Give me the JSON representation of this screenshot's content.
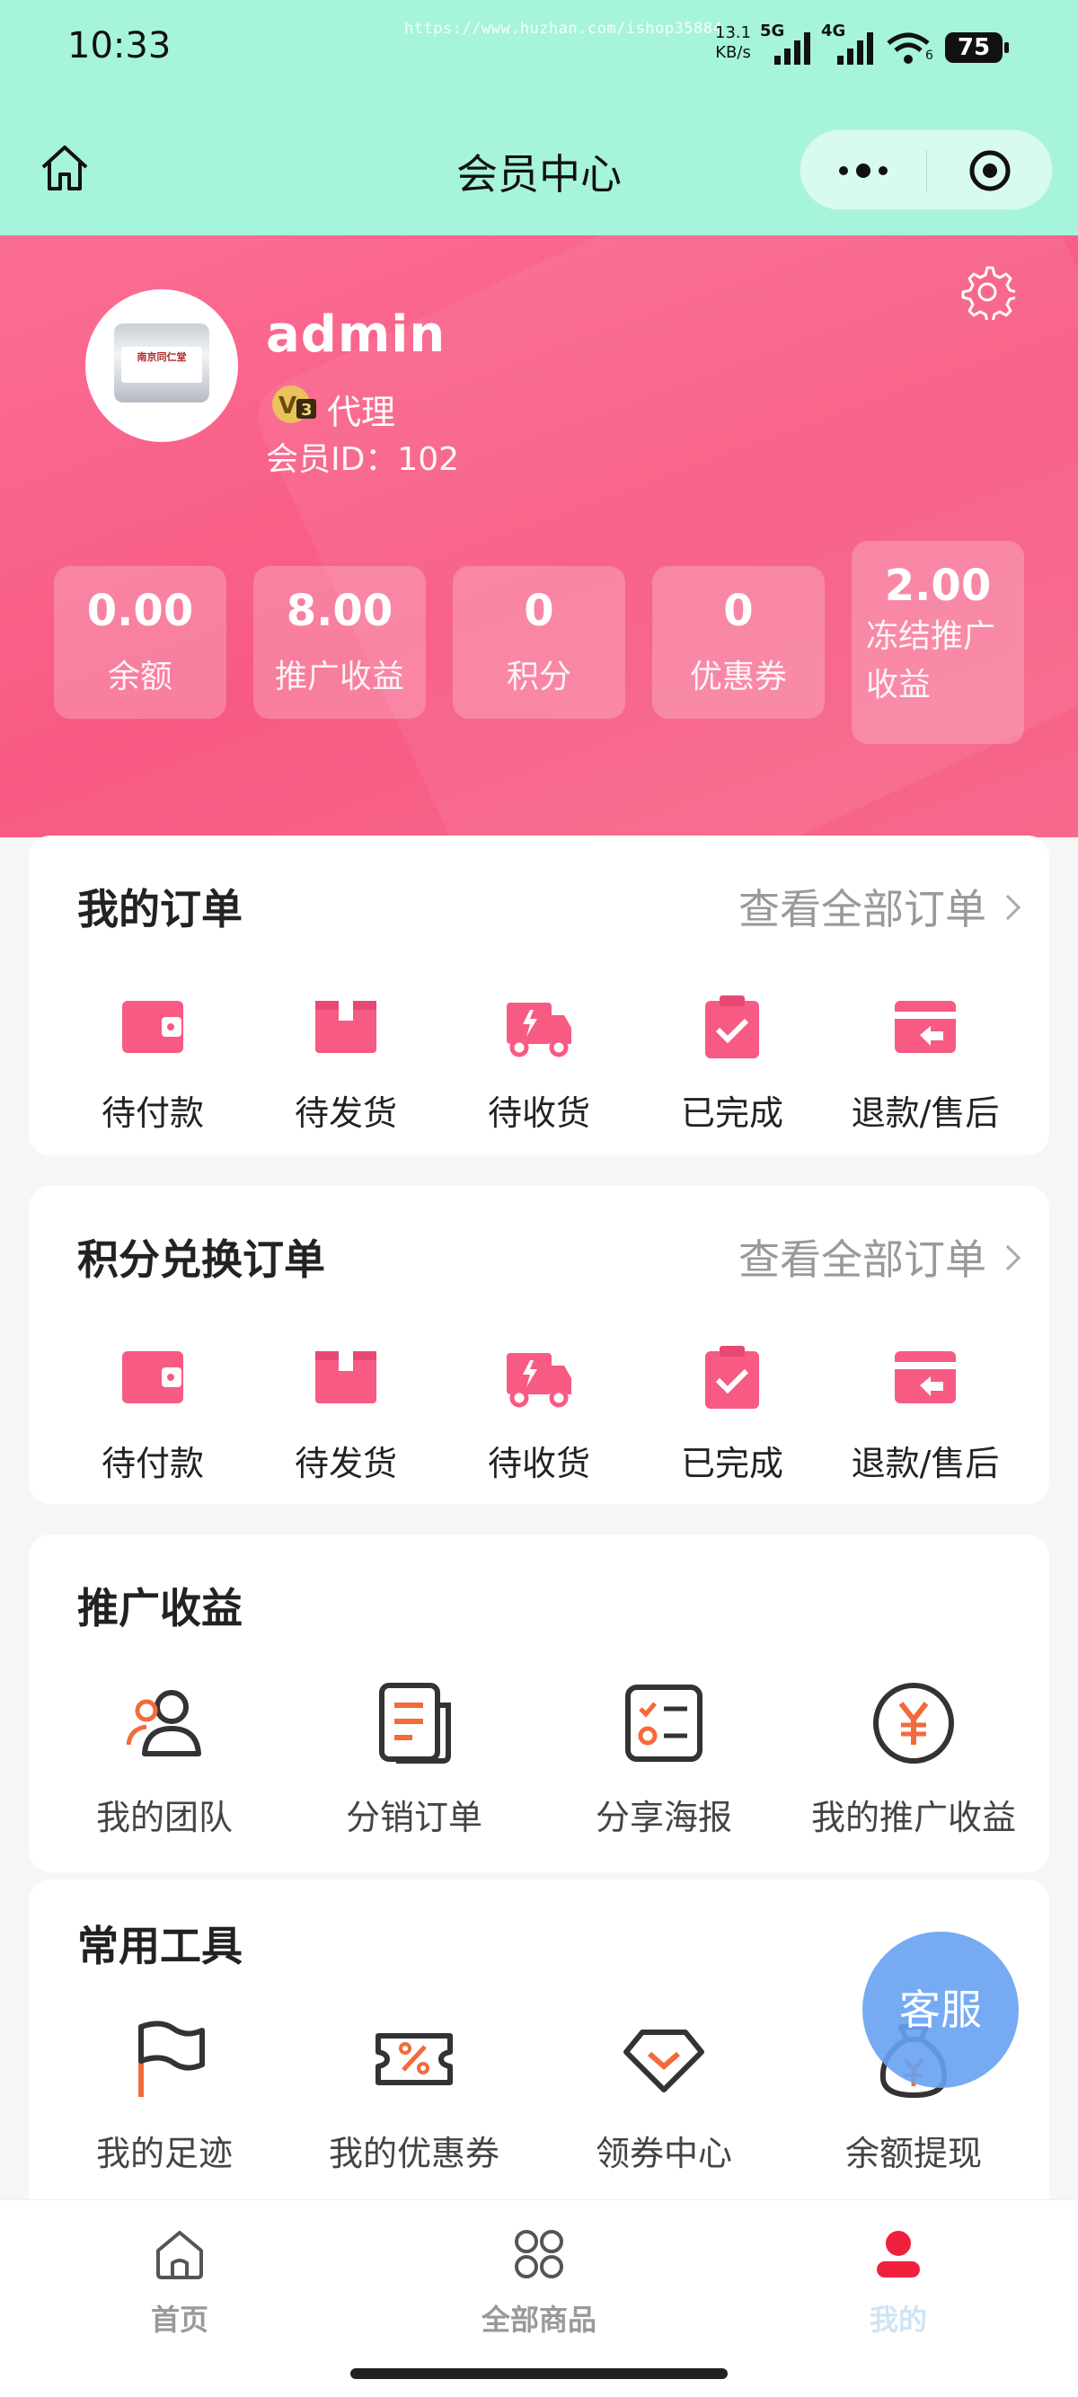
{
  "status_bar": {
    "time": "10:33",
    "url_watermark": "https://www.huzhan.com/ishop35884",
    "net_speed_value": "13.1",
    "net_speed_unit": "KB/s",
    "signal_1": "5G",
    "signal_2": "4G",
    "wifi_sub": "6",
    "battery": "75"
  },
  "navbar": {
    "title": "会员中心"
  },
  "profile": {
    "username": "admin",
    "level": "代理",
    "member_id": "会员ID：102",
    "avatar_label": "南京同仁堂"
  },
  "stats": [
    {
      "value": "0.00",
      "label": "余额"
    },
    {
      "value": "8.00",
      "label": "推广收益"
    },
    {
      "value": "0",
      "label": "积分"
    },
    {
      "value": "0",
      "label": "优惠券"
    },
    {
      "value": "2.00",
      "label": "冻结推广收益"
    }
  ],
  "orders": {
    "title": "我的订单",
    "link": "查看全部订单",
    "items": [
      {
        "label": "待付款",
        "icon": "wallet-icon"
      },
      {
        "label": "待发货",
        "icon": "box-icon"
      },
      {
        "label": "待收货",
        "icon": "truck-icon"
      },
      {
        "label": "已完成",
        "icon": "clipboard-check-icon"
      },
      {
        "label": "退款/售后",
        "icon": "refund-icon"
      }
    ]
  },
  "points_orders": {
    "title": "积分兑换订单",
    "link": "查看全部订单",
    "items": [
      {
        "label": "待付款",
        "icon": "wallet-icon"
      },
      {
        "label": "待发货",
        "icon": "box-icon"
      },
      {
        "label": "待收货",
        "icon": "truck-icon"
      },
      {
        "label": "已完成",
        "icon": "clipboard-check-icon"
      },
      {
        "label": "退款/售后",
        "icon": "refund-icon"
      }
    ]
  },
  "promotion": {
    "title": "推广收益",
    "items": [
      {
        "label": "我的团队",
        "icon": "team-icon"
      },
      {
        "label": "分销订单",
        "icon": "document-icon"
      },
      {
        "label": "分享海报",
        "icon": "poster-icon"
      },
      {
        "label": "我的推广收益",
        "icon": "yen-circle-icon"
      }
    ]
  },
  "tools": {
    "title": "常用工具",
    "items": [
      {
        "label": "我的足迹",
        "icon": "flag-icon"
      },
      {
        "label": "我的优惠券",
        "icon": "coupon-icon"
      },
      {
        "label": "领券中心",
        "icon": "coupon-center-icon"
      },
      {
        "label": "余额提现",
        "icon": "money-bag-icon"
      }
    ]
  },
  "floating": {
    "service": "客服"
  },
  "tabbar": {
    "items": [
      {
        "label": "首页",
        "icon": "home-icon"
      },
      {
        "label": "全部商品",
        "icon": "grid-icon"
      },
      {
        "label": "我的",
        "icon": "user-icon"
      }
    ]
  },
  "colors": {
    "accent": "#f75a83",
    "header_bg": "#a6f4dc",
    "service_button": "#67a2f2"
  }
}
